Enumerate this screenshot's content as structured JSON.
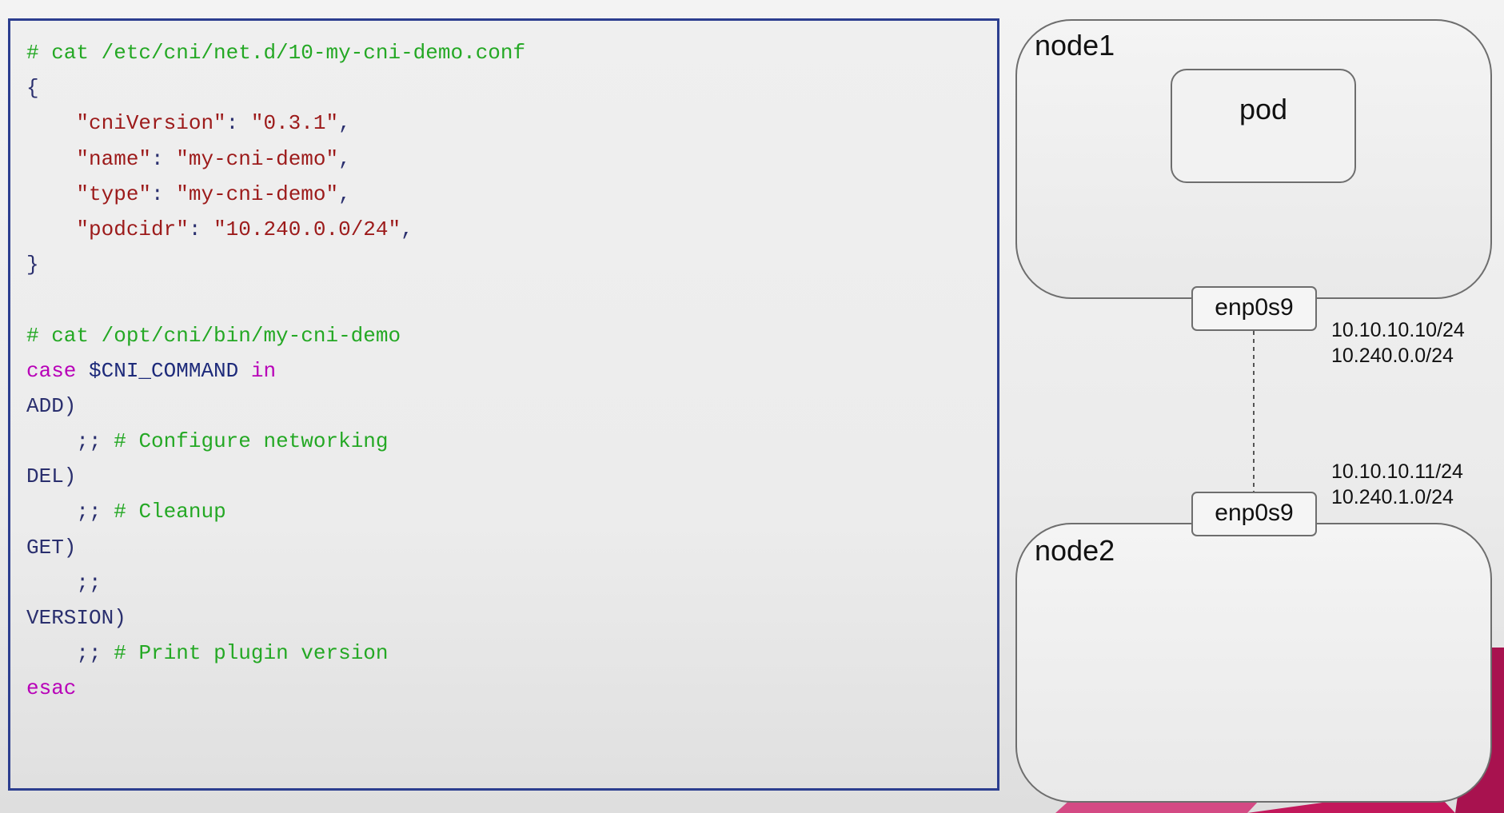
{
  "code": {
    "lines": [
      [
        {
          "t": "# cat /etc/cni/net.d/10-my-cni-demo.conf",
          "k": "comment"
        }
      ],
      [
        {
          "t": "{",
          "k": "punct"
        }
      ],
      [
        {
          "t": "    ",
          "k": "punct"
        },
        {
          "t": "\"cniVersion\"",
          "k": "str"
        },
        {
          "t": ": ",
          "k": "punct"
        },
        {
          "t": "\"0.3.1\"",
          "k": "str"
        },
        {
          "t": ",",
          "k": "punct"
        }
      ],
      [
        {
          "t": "    ",
          "k": "punct"
        },
        {
          "t": "\"name\"",
          "k": "str"
        },
        {
          "t": ": ",
          "k": "punct"
        },
        {
          "t": "\"my-cni-demo\"",
          "k": "str"
        },
        {
          "t": ",",
          "k": "punct"
        }
      ],
      [
        {
          "t": "    ",
          "k": "punct"
        },
        {
          "t": "\"type\"",
          "k": "str"
        },
        {
          "t": ": ",
          "k": "punct"
        },
        {
          "t": "\"my-cni-demo\"",
          "k": "str"
        },
        {
          "t": ",",
          "k": "punct"
        }
      ],
      [
        {
          "t": "    ",
          "k": "punct"
        },
        {
          "t": "\"podcidr\"",
          "k": "str"
        },
        {
          "t": ": ",
          "k": "punct"
        },
        {
          "t": "\"10.240.0.0/24\"",
          "k": "str"
        },
        {
          "t": ",",
          "k": "punct"
        }
      ],
      [
        {
          "t": "}",
          "k": "punct"
        }
      ],
      [],
      [
        {
          "t": "# cat /opt/cni/bin/my-cni-demo",
          "k": "comment"
        }
      ],
      [
        {
          "t": "case",
          "k": "kw"
        },
        {
          "t": " $CNI_COMMAND ",
          "k": "var"
        },
        {
          "t": "in",
          "k": "kw"
        }
      ],
      [
        {
          "t": "ADD)",
          "k": "label"
        }
      ],
      [
        {
          "t": "    ",
          "k": "punct"
        },
        {
          "t": ";;",
          "k": "punct"
        },
        {
          "t": " # Configure networking",
          "k": "comment"
        }
      ],
      [
        {
          "t": "DEL)",
          "k": "label"
        }
      ],
      [
        {
          "t": "    ",
          "k": "punct"
        },
        {
          "t": ";;",
          "k": "punct"
        },
        {
          "t": " # Cleanup",
          "k": "comment"
        }
      ],
      [
        {
          "t": "GET)",
          "k": "label"
        }
      ],
      [
        {
          "t": "    ",
          "k": "punct"
        },
        {
          "t": ";;",
          "k": "punct"
        }
      ],
      [
        {
          "t": "VERSION)",
          "k": "label"
        }
      ],
      [
        {
          "t": "    ",
          "k": "punct"
        },
        {
          "t": ";;",
          "k": "punct"
        },
        {
          "t": " # Print plugin version",
          "k": "comment"
        }
      ],
      [
        {
          "t": "esac",
          "k": "kw"
        }
      ]
    ]
  },
  "diagram": {
    "node1": {
      "label": "node1",
      "pod_label": "pod",
      "iface": "enp0s9",
      "ip": "10.10.10.10/24",
      "cidr": "10.240.0.0/24"
    },
    "node2": {
      "label": "node2",
      "iface": "enp0s9",
      "ip": "10.10.10.11/24",
      "cidr": "10.240.1.0/24"
    }
  },
  "colors": {
    "code_border": "#2c3e8f",
    "comment": "#24a824",
    "string": "#9c1a1a",
    "keyword": "#b800b8",
    "text": "#2a2f6e",
    "accent": "#c2185b"
  }
}
